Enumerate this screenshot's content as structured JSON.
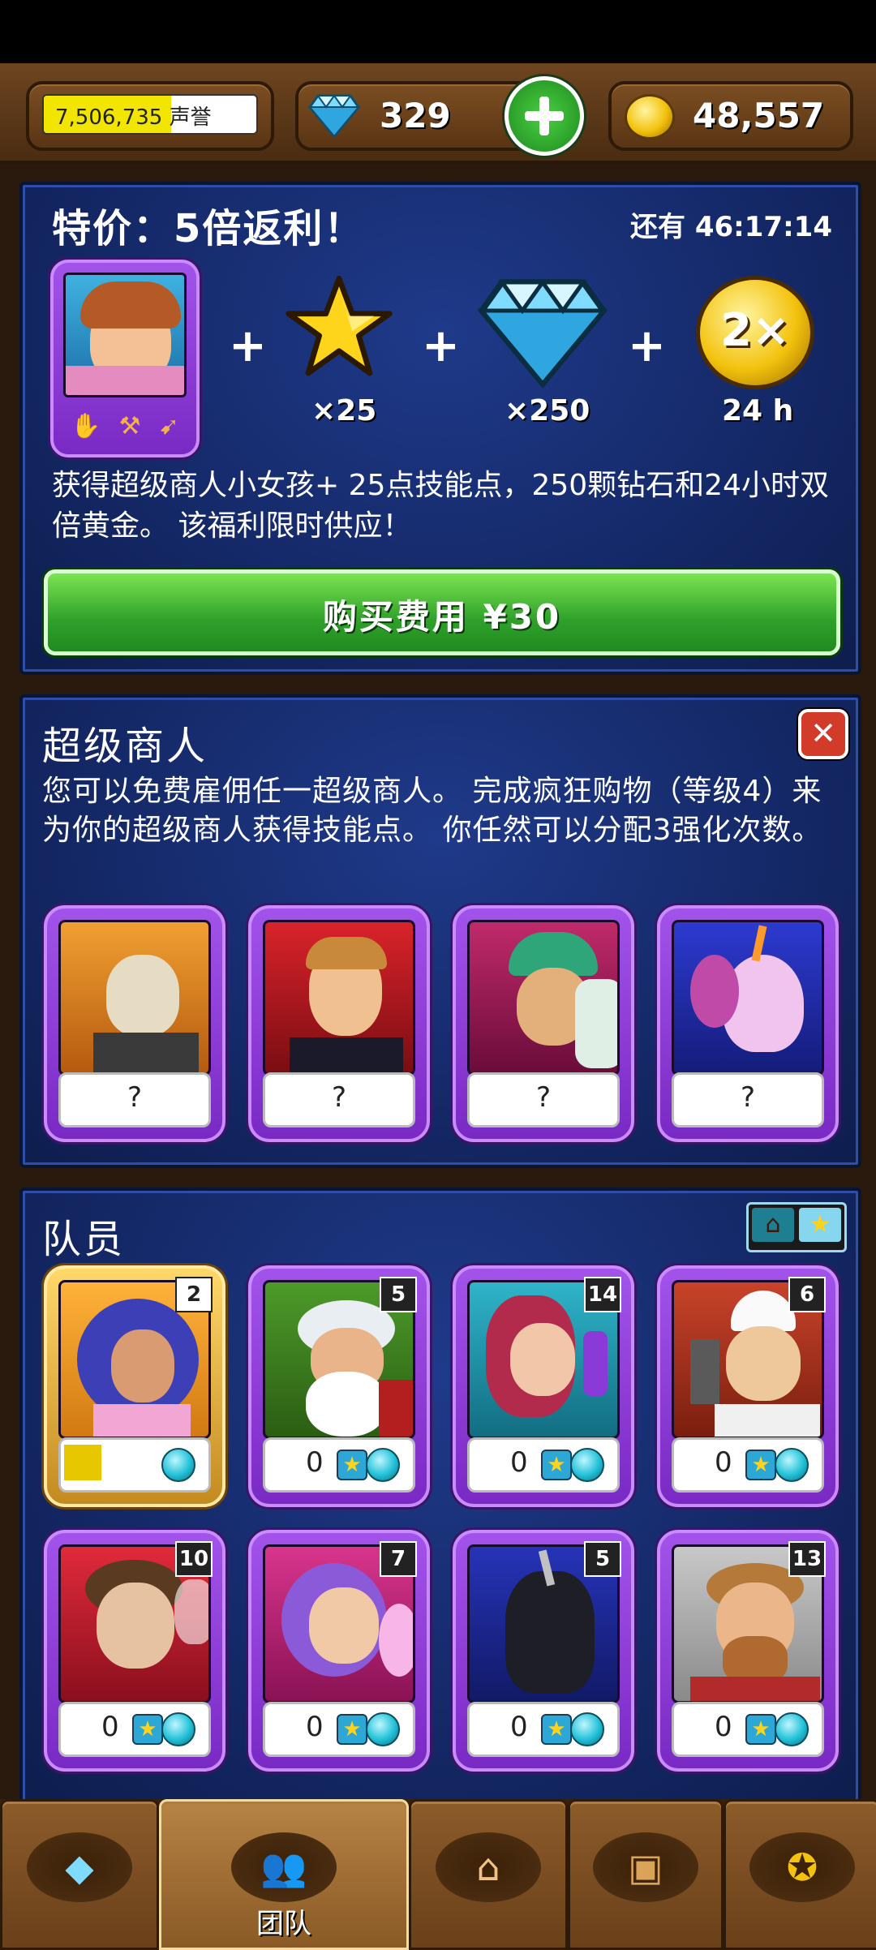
{
  "topbar": {
    "reputation_value": "7,506,735",
    "reputation_label": "声誉",
    "reputation_progress": 0.6,
    "gems": "329",
    "gold": "48,557"
  },
  "offer": {
    "title": "特价：5倍返利！",
    "timer": "还有 46:17:14",
    "plus": "+",
    "stars_qty": "×25",
    "gems_qty": "×250",
    "gold_label": "2×",
    "gold_qty": "24 h",
    "description": "获得超级商人小女孩+ 25点技能点，250颗钻石和24小时双倍黄金。 该福利限时供应！",
    "buy_label": "购买费用 ¥30"
  },
  "super_merchant": {
    "title": "超级商人",
    "description": "您可以免费雇佣任一超级商人。 完成疯狂购物（等级4）来为你的超级商人获得技能点。 你任然可以分配3强化次数。",
    "cards": [
      {
        "name": "skeleton",
        "label": "?"
      },
      {
        "name": "gentleman",
        "label": "?"
      },
      {
        "name": "warrior",
        "label": "?"
      },
      {
        "name": "unicorn",
        "label": "?"
      }
    ]
  },
  "team": {
    "title": "队员",
    "members": [
      {
        "name": "unicorn-girl",
        "level": "2",
        "progress": 0.25,
        "stars": "",
        "gold": true
      },
      {
        "name": "santa",
        "level": "5",
        "stars": "0"
      },
      {
        "name": "elf-alchemist",
        "level": "14",
        "stars": "0"
      },
      {
        "name": "chef",
        "level": "6",
        "stars": "0"
      },
      {
        "name": "scared-man",
        "level": "10",
        "stars": "0"
      },
      {
        "name": "fairy",
        "level": "7",
        "stars": "0"
      },
      {
        "name": "black-unicorn",
        "level": "5",
        "stars": "0"
      },
      {
        "name": "lumberjack",
        "level": "13",
        "stars": "0"
      }
    ]
  },
  "nav": {
    "items": [
      {
        "icon": "gem-icon"
      },
      {
        "icon": "team-icon",
        "label": "团队"
      },
      {
        "icon": "shop-icon"
      },
      {
        "icon": "chest-icon"
      },
      {
        "icon": "medal-icon"
      }
    ]
  },
  "colors": {
    "accent_green": "#3cbf2f",
    "panel_blue": "#142866",
    "card_purple": "#8a3ad6"
  }
}
